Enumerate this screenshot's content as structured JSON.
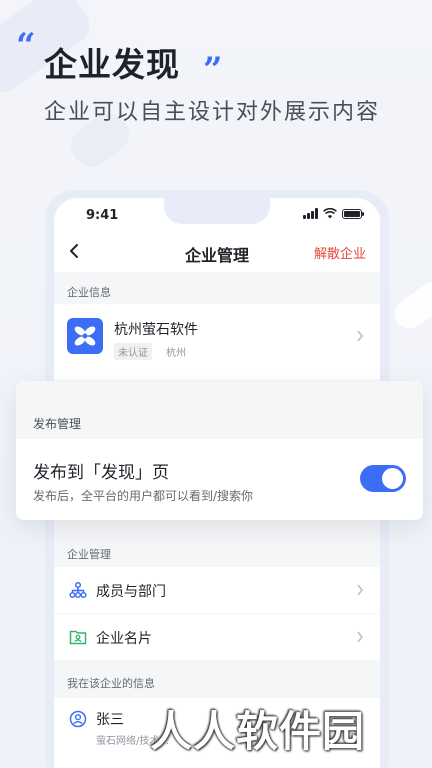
{
  "promo": {
    "title": "企业发现",
    "subtitle": "企业可以自主设计对外展示内容"
  },
  "status_bar": {
    "time": "9:41"
  },
  "nav": {
    "title": "企业管理",
    "action": "解散企业"
  },
  "company_info": {
    "section_label": "企业信息",
    "name": "杭州萤石软件",
    "badge": "未认证",
    "city": "杭州"
  },
  "publish": {
    "section_label": "发布管理",
    "title": "发布到「发现」页",
    "description": "发布后，全平台的用户都可以看到/搜索你",
    "enabled": true
  },
  "management": {
    "section_label": "企业管理",
    "items": [
      {
        "label": "成员与部门",
        "icon": "org-chart-icon"
      },
      {
        "label": "企业名片",
        "icon": "business-card-icon"
      }
    ]
  },
  "my_info": {
    "section_label": "我在该企业的信息",
    "name": "张三",
    "detail": "萤石网络/技术..."
  },
  "watermark": "人人软件园",
  "colors": {
    "accent": "#3b6ef5",
    "danger": "#e8453c"
  }
}
